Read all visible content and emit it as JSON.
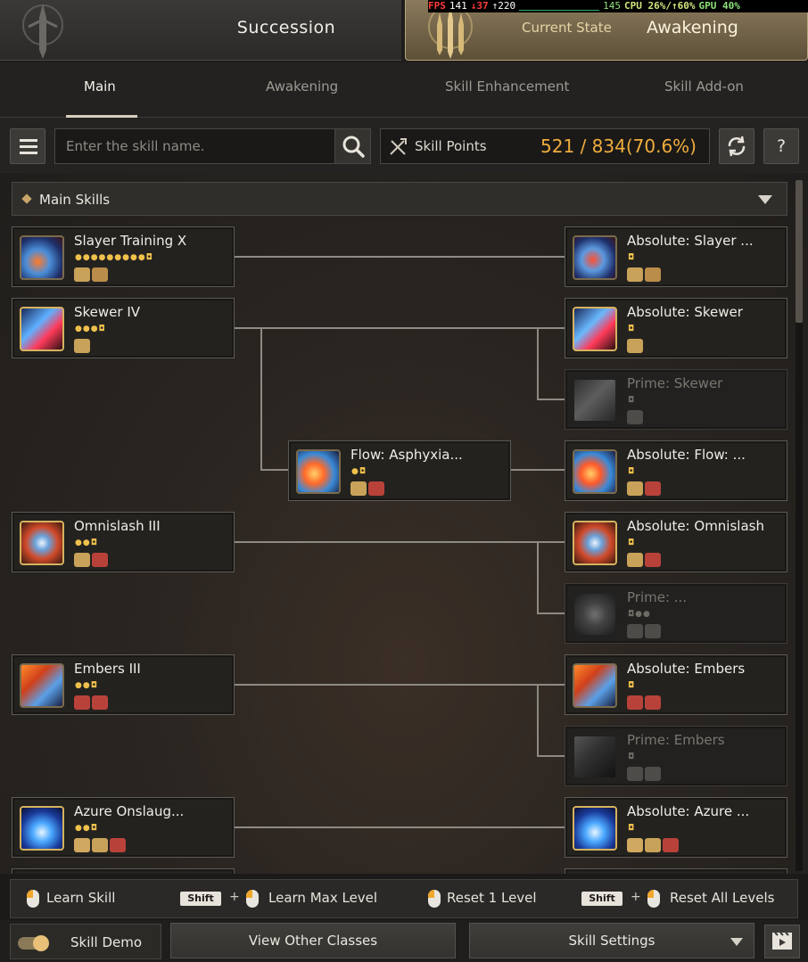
{
  "header": {
    "succession_label": "Succession",
    "current_state_label": "Current State",
    "awakening_label": "Awakening"
  },
  "perf": {
    "fps_label": "FPS",
    "fps": "141",
    "fps_low": "↓37",
    "fps_high": "↑220",
    "graph_peak": "145",
    "cpu": "CPU 26%/↑60%",
    "gpu": "GPU 40%"
  },
  "subtabs": [
    "Main",
    "Awakening",
    "Skill Enhancement",
    "Skill Add-on"
  ],
  "search": {
    "placeholder": "Enter the skill name."
  },
  "skill_points": {
    "label": "Skill Points",
    "value": "521 / 834(70.6%)"
  },
  "help_label": "?",
  "section": {
    "title": "Main Skills"
  },
  "skills": [
    {
      "name": "Slayer Training X",
      "pips": "●●●●●●●●●◘"
    },
    {
      "name": "Absolute: Slayer ...",
      "pips": "◘"
    },
    {
      "name": "Skewer IV",
      "pips": "●●●◘"
    },
    {
      "name": "Absolute: Skewer",
      "pips": "◘"
    },
    {
      "name": "Prime: Skewer",
      "pips": "◘"
    },
    {
      "name": "Flow: Asphyxia...",
      "pips": "●◘"
    },
    {
      "name": "Absolute: Flow: ...",
      "pips": "◘"
    },
    {
      "name": "Omnislash III",
      "pips": "●●◘"
    },
    {
      "name": "Absolute: Omnislash",
      "pips": "◘"
    },
    {
      "name": "Prime: ...",
      "pips": "◘●●"
    },
    {
      "name": "Embers III",
      "pips": "●●◘"
    },
    {
      "name": "Absolute: Embers",
      "pips": "◘"
    },
    {
      "name": "Prime: Embers",
      "pips": "◘"
    },
    {
      "name": "Azure Onslaug...",
      "pips": "●●◘"
    },
    {
      "name": "Absolute: Azure ...",
      "pips": "◘"
    }
  ],
  "hints": {
    "learn_skill": "Learn Skill",
    "shift": "Shift",
    "plus": "+",
    "learn_max": "Learn Max Level",
    "reset_one": "Reset 1 Level",
    "reset_all": "Reset All Levels"
  },
  "footer": {
    "skill_demo": "Skill Demo",
    "view_other_classes": "View Other Classes",
    "skill_settings": "Skill Settings"
  },
  "colors": {
    "accent_gold": "#f0ad3d",
    "pip_gold": "#f0c04c",
    "mouse_orange": "#f0a82c"
  }
}
